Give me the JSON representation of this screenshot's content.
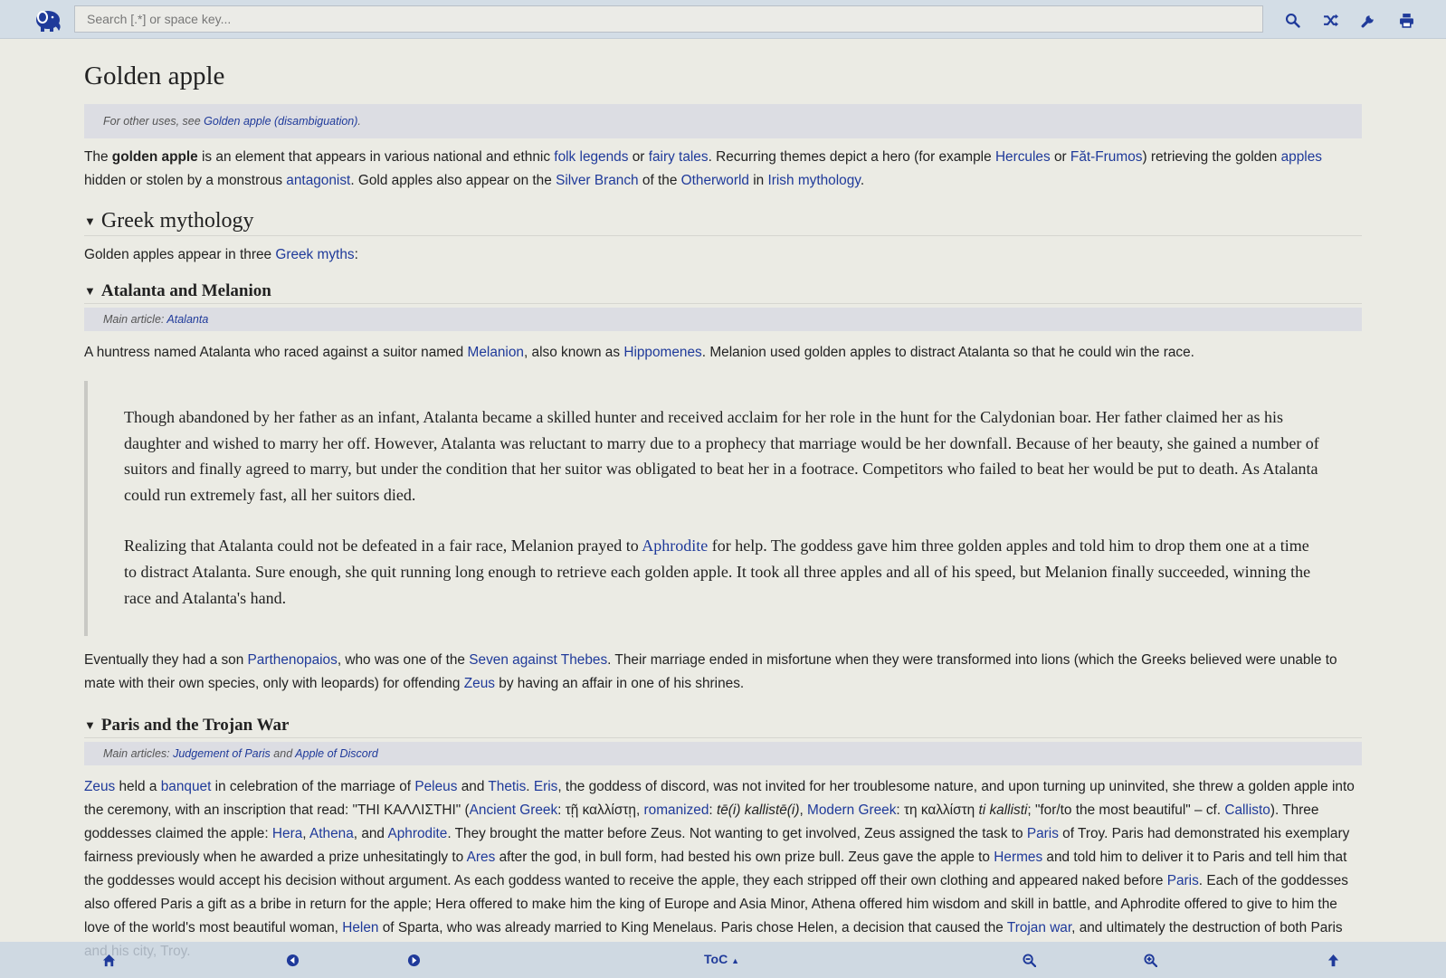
{
  "topbar": {
    "search_placeholder": "Search [.*] or space key...",
    "icons": [
      "search-icon",
      "random-icon",
      "wrench-icon",
      "print-icon"
    ]
  },
  "article": {
    "title": "Golden apple",
    "hatnote": {
      "prefix": "For other uses, see ",
      "link": "Golden apple (disambiguation)",
      "suffix": "."
    },
    "intro": {
      "t1": "The ",
      "bold": "golden apple",
      "t2": " is an element that appears in various national and ethnic ",
      "l1": "folk legends",
      "t3": " or ",
      "l2": "fairy tales",
      "t4": ". Recurring themes depict a hero (for example ",
      "l3": "Hercules",
      "t5": " or ",
      "l4": "Făt-Frumos",
      "t6": ") retrieving the golden ",
      "l5": "apples",
      "t7": " hidden or stolen by a monstrous ",
      "l6": "antagonist",
      "t8": ". Gold apples also appear on the ",
      "l7": "Silver Branch",
      "t9": " of the ",
      "l8": "Otherworld",
      "t10": " in ",
      "l9": "Irish mythology",
      "t11": "."
    },
    "greek": {
      "heading": "Greek mythology",
      "intro_t1": "Golden apples appear in three ",
      "intro_l1": "Greek myths",
      "intro_t2": ":"
    },
    "atalanta": {
      "heading": "Atalanta and Melanion",
      "hatnote_prefix": "Main article: ",
      "hatnote_link": "Atalanta",
      "p1_t1": "A huntress named Atalanta who raced against a suitor named ",
      "p1_l1": "Melanion",
      "p1_t2": ", also known as ",
      "p1_l2": "Hippomenes",
      "p1_t3": ". Melanion used golden apples to distract Atalanta so that he could win the race.",
      "quote_p1": "Though abandoned by her father as an infant, Atalanta became a skilled hunter and received acclaim for her role in the hunt for the Calydonian boar. Her father claimed her as his daughter and wished to marry her off. However, Atalanta was reluctant to marry due to a prophecy that marriage would be her downfall. Because of her beauty, she gained a number of suitors and finally agreed to marry, but under the condition that her suitor was obligated to beat her in a footrace. Competitors who failed to beat her would be put to death. As Atalanta could run extremely fast, all her suitors died.",
      "quote_p2_t1": "Realizing that Atalanta could not be defeated in a fair race, Melanion prayed to ",
      "quote_p2_l1": "Aphrodite",
      "quote_p2_t2": " for help. The goddess gave him three golden apples and told him to drop them one at a time to distract Atalanta. Sure enough, she quit running long enough to retrieve each golden apple. It took all three apples and all of his speed, but Melanion finally succeeded, winning the race and Atalanta's hand.",
      "p2_t1": "Eventually they had a son ",
      "p2_l1": "Parthenopaios",
      "p2_t2": ", who was one of the ",
      "p2_l2": "Seven against Thebes",
      "p2_t3": ". Their marriage ended in misfortune when they were transformed into lions (which the Greeks believed were unable to mate with their own species, only with leopards) for offending ",
      "p2_l3": "Zeus",
      "p2_t4": " by having an affair in one of his shrines."
    },
    "paris": {
      "heading": "Paris and the Trojan War",
      "hatnote_prefix": "Main articles: ",
      "hatnote_l1": "Judgement of Paris",
      "hatnote_and": " and ",
      "hatnote_l2": "Apple of Discord",
      "l1": "Zeus",
      "t1": " held a ",
      "l2": "banquet",
      "t2": " in celebration of the marriage of ",
      "l3": "Peleus",
      "t3": " and ",
      "l4": "Thetis",
      "t4": ". ",
      "l5": "Eris",
      "t5": ", the goddess of discord, was not invited for her troublesome nature, and upon turning up uninvited, she threw a golden apple into the ceremony, with an inscription that read: \"ΤΗΙ ΚΑΛΛΙΣΤΗΙ\" (",
      "l6": "Ancient Greek",
      "t6": ": τῇ καλλίστῃ, ",
      "l7": "romanized",
      "t7": ": ",
      "i1": "tē(i) kallistē(i)",
      "t8": ", ",
      "l8": "Modern Greek",
      "t9": ": τη καλλίστη ",
      "i2": "ti kallisti",
      "t10": "; \"for/to the most beautiful\" – cf. ",
      "l9": "Callisto",
      "t11": "). Three goddesses claimed the apple: ",
      "l10": "Hera",
      "t12": ", ",
      "l11": "Athena",
      "t13": ", and ",
      "l12": "Aphrodite",
      "t14": ". They brought the matter before Zeus. Not wanting to get involved, Zeus assigned the task to ",
      "l13": "Paris",
      "t15": " of Troy. Paris had demonstrated his exemplary fairness previously when he awarded a prize unhesitatingly to ",
      "l14": "Ares",
      "t16": " after the god, in bull form, had bested his own prize bull. Zeus gave the apple to ",
      "l15": "Hermes",
      "t17": " and told him to deliver it to Paris and tell him that the goddesses would accept his decision without argument. As each goddess wanted to receive the apple, they each stripped off their own clothing and appeared naked before ",
      "l16": "Paris",
      "t18": ". Each of the goddesses also offered Paris a gift as a bribe in return for the apple; Hera offered to make him the king of Europe and Asia Minor, Athena offered him wisdom and skill in battle, and Aphrodite offered to give to him the love of the world's most beautiful woman, ",
      "l17": "Helen",
      "t19": " of Sparta, who was already married to King Menelaus. Paris chose Helen, a decision that caused the ",
      "l18": "Trojan war",
      "t20": ", and ultimately the destruction of both Paris and his city, Troy."
    }
  },
  "bottombar": {
    "toc_label": "ToC",
    "icons": [
      "home-icon",
      "back-icon",
      "forward-icon",
      "zoom-out-icon",
      "zoom-in-icon",
      "arrow-up-icon"
    ]
  }
}
